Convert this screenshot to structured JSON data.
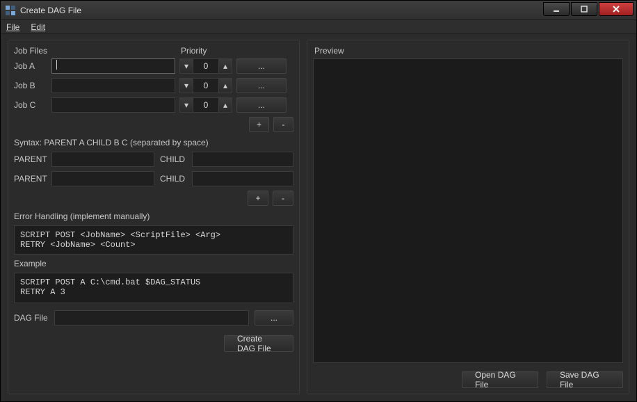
{
  "window": {
    "title": "Create DAG File"
  },
  "menu": {
    "file": "File",
    "edit": "Edit"
  },
  "left": {
    "headers": {
      "jobfiles": "Job Files",
      "priority": "Priority"
    },
    "jobs": [
      {
        "label": "Job A",
        "path": "",
        "priority": 0
      },
      {
        "label": "Job B",
        "path": "",
        "priority": 0
      },
      {
        "label": "Job C",
        "path": "",
        "priority": 0
      }
    ],
    "browse": "...",
    "plus": "+",
    "minus": "-",
    "syntax": "Syntax: PARENT A CHILD B C (separated by space)",
    "rel_parent_lbl": "PARENT",
    "rel_child_lbl": "CHILD",
    "relations": [
      {
        "parent": "",
        "child": ""
      },
      {
        "parent": "",
        "child": ""
      }
    ],
    "error_heading": "Error Handling (implement manually)",
    "error_template": "SCRIPT POST <JobName> <ScriptFile> <Arg>\nRETRY <JobName> <Count>",
    "example_heading": "Example",
    "example_text": "SCRIPT POST A C:\\cmd.bat $DAG_STATUS\nRETRY A 3",
    "dagfile_label": "DAG File",
    "dagfile_value": "",
    "create_btn": "Create DAG File"
  },
  "right": {
    "preview_label": "Preview",
    "preview_content": "",
    "open_btn": "Open DAG File",
    "save_btn": "Save DAG File"
  }
}
